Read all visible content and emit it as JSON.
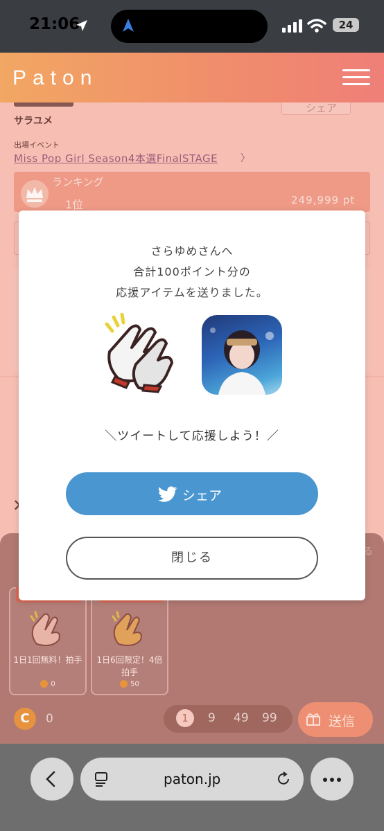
{
  "status_bar": {
    "time": "21:06",
    "battery": "24"
  },
  "header": {
    "logo": "Paton"
  },
  "profile": {
    "name": "サラユメ",
    "share_label": "シェア",
    "event_label": "出場イベント",
    "event_name": "Miss Pop Girl Season4本選FinalSTAGE",
    "event_chevron": "〉",
    "ranking_label": "ランキング",
    "rank": "1位",
    "points": "249,999 pt"
  },
  "gift_panel": {
    "items": [
      {
        "name": "1日1回無料！拍手",
        "cost": "0"
      },
      {
        "name": "1日6回限定！4倍拍手",
        "cost": "50"
      }
    ],
    "coin_symbol": "C",
    "coin_count": "0",
    "quantities": [
      "1",
      "9",
      "49",
      "99"
    ],
    "send_label": "送信",
    "right_edge_text": "る"
  },
  "modal": {
    "line1": "さらゆめさんへ",
    "line2": "合計100ポイント分の",
    "line3": "応援アイテムを送りました。",
    "tweet_prompt": "＼ツイートして応援しよう！／",
    "share_button": "シェア",
    "close_button": "閉じる"
  },
  "browser": {
    "url": "paton.jp"
  },
  "colors": {
    "header_start": "#f2a763",
    "header_end": "#ef7f78",
    "share_button": "#4a96d0",
    "overlay": "#f7bfb4"
  }
}
